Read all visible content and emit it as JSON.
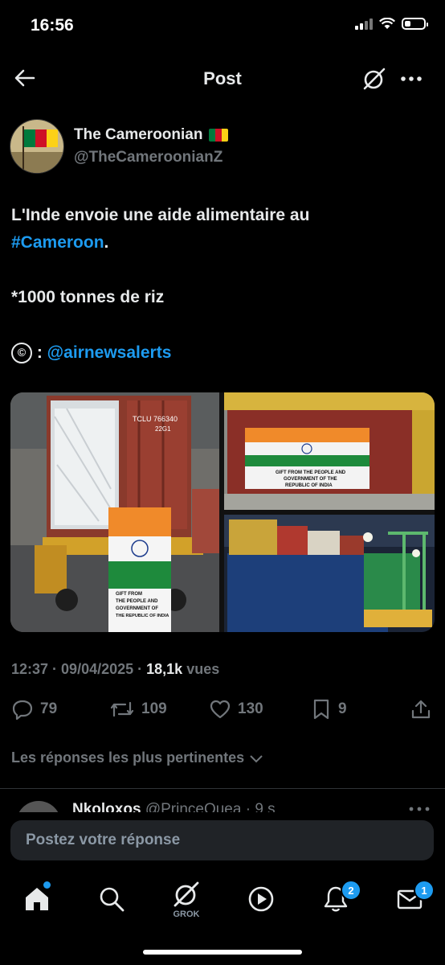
{
  "status_bar": {
    "time": "16:56",
    "battery_level": 0.3
  },
  "header": {
    "title": "Post"
  },
  "author": {
    "name": "The Cameroonian",
    "handle": "@TheCameroonianZ",
    "flag": [
      "#007a3d",
      "#ce1126",
      "#fcd116"
    ]
  },
  "post": {
    "line1": "L'Inde envoie une aide alimentaire au",
    "hashtag": "#Cameroon",
    "hashtag_suffix": ".",
    "line3": "*1000 tonnes de riz",
    "credit_symbol": "©",
    "credit_sep": " : ",
    "mention": "@airnewsalerts"
  },
  "media": {
    "photo1": {
      "container_code": "TCLU  766340",
      "container_sub": "22G1",
      "sign_text": [
        "GIFT FROM",
        "THE PEOPLE AND",
        "GOVERNMENT OF",
        "THE REPUBLIC OF INDIA"
      ]
    },
    "photo2": {
      "banner_text": [
        "GIFT FROM THE PEOPLE AND",
        "GOVERNMENT OF THE",
        "REPUBLIC OF INDIA"
      ]
    }
  },
  "meta": {
    "time": "12:37",
    "sep1": " · ",
    "date": "09/04/2025",
    "sep2": " · ",
    "views": "18,1k",
    "views_label": " vues"
  },
  "actions": {
    "replies": "79",
    "reposts": "109",
    "likes": "130",
    "bookmarks": "9"
  },
  "sort": {
    "label": "Les réponses les plus pertinentes"
  },
  "reply_peek": {
    "name": "Nkoloxos",
    "handle": "@PrinceQuea · 9 s"
  },
  "reply_box": {
    "placeholder": "Postez votre réponse"
  },
  "tabbar": {
    "grok_label": "GROK",
    "notifications_badge": "2",
    "messages_badge": "1"
  },
  "colors": {
    "accent": "#1d9bf0",
    "background": "#000000",
    "muted": "#71767b"
  }
}
